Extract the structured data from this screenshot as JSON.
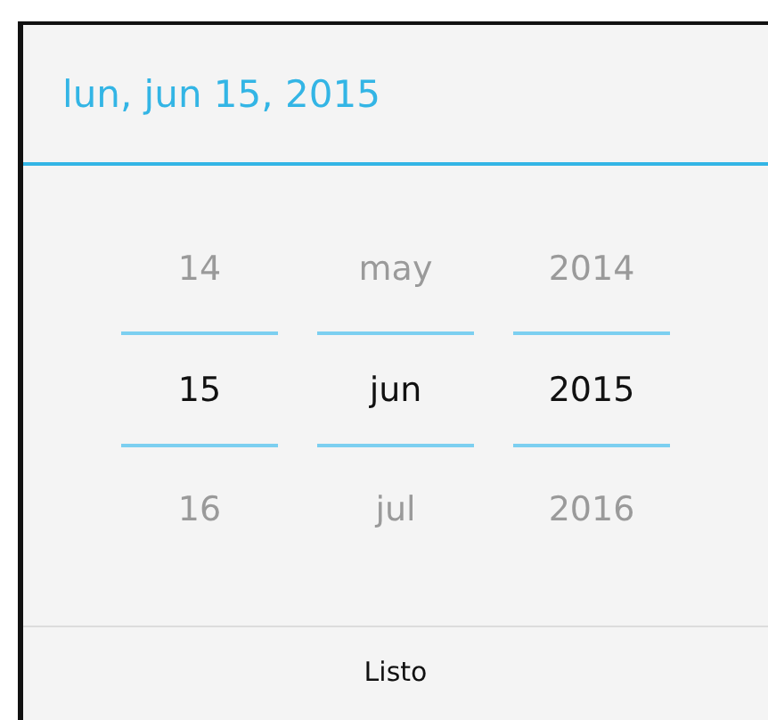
{
  "title": "lun, jun 15, 2015",
  "pickers": [
    {
      "values": [
        {
          "text": "14",
          "selected": false
        },
        {
          "text": "15",
          "selected": true
        },
        {
          "text": "16",
          "selected": false
        }
      ]
    },
    {
      "values": [
        {
          "text": "may",
          "selected": false
        },
        {
          "text": "jun",
          "selected": true
        },
        {
          "text": "jul",
          "selected": false
        }
      ]
    },
    {
      "values": [
        {
          "text": "2014",
          "selected": false
        },
        {
          "text": "2015",
          "selected": true
        },
        {
          "text": "2016",
          "selected": false
        }
      ]
    }
  ],
  "button": "Listo"
}
